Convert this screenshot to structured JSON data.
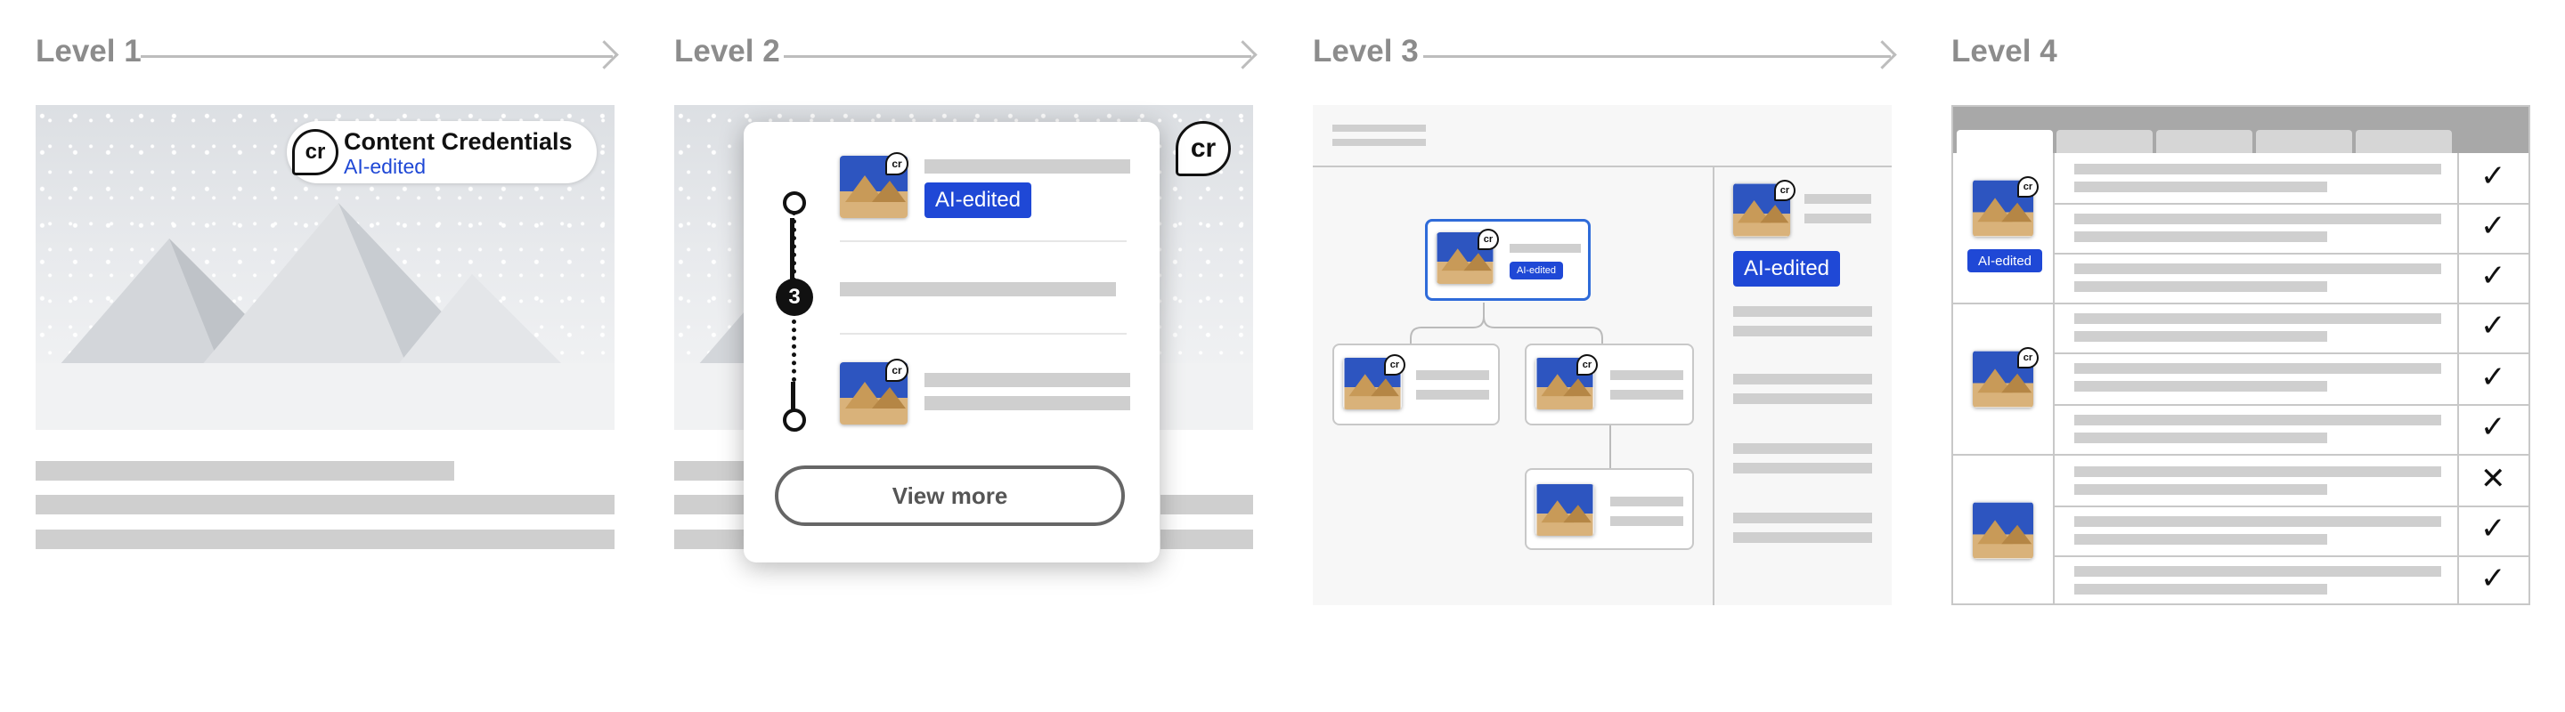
{
  "levels": [
    "Level 1",
    "Level 2",
    "Level 3",
    "Level 4"
  ],
  "level1": {
    "badge_title": "Content Credentials",
    "badge_sub": "AI-edited"
  },
  "level2": {
    "tag": "AI-edited",
    "step_count": "3",
    "button": "View more"
  },
  "level3": {
    "node_tag": "AI-edited",
    "side_tag": "AI-edited"
  },
  "level4": {
    "row_tag": "AI-edited",
    "marks": [
      "✓",
      "✓",
      "✓",
      "✓",
      "✓",
      "✓",
      "✕",
      "✓",
      "✓"
    ]
  },
  "cr_label": "cr",
  "colors": {
    "accent": "#1f48d6",
    "label": "#8c8c8c",
    "bar": "#cfcfcf"
  }
}
